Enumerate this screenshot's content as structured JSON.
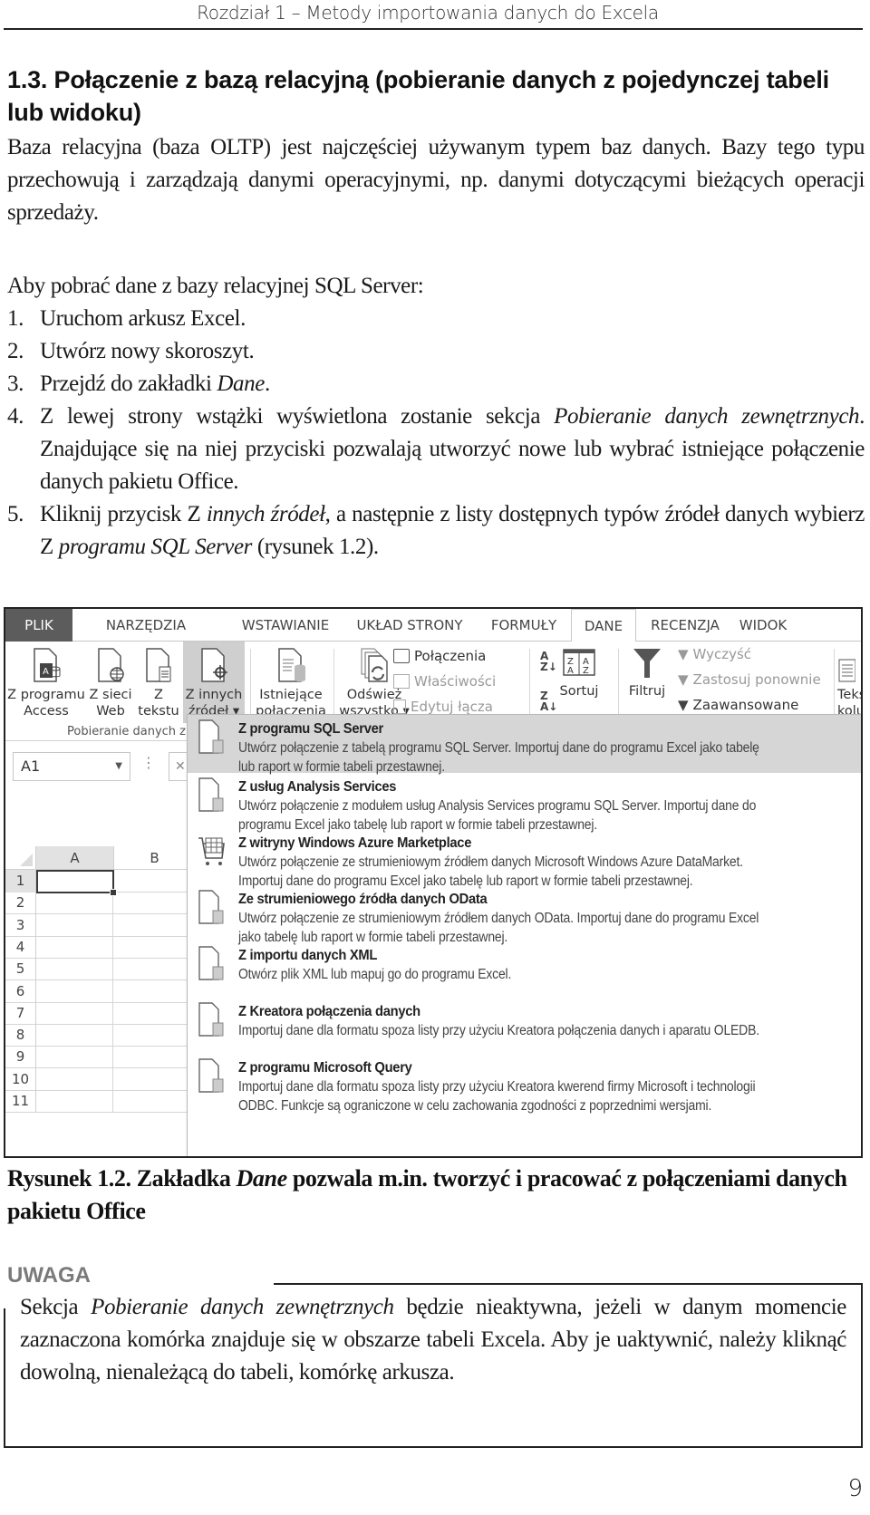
{
  "running_head": "Rozdział 1 – Metody importowania danych do Excela",
  "section_title": "1.3. Połączenie z bazą relacyjną (pobieranie danych z pojedynczej tabeli lub widoku)",
  "paragraph1": "Baza relacyjna (baza OLTP) jest najczęściej używanym typem baz danych. Bazy tego typu przechowują i zarządzają danymi operacyjnymi, np. danymi dotyczącymi bieżących operacji sprzedaży.",
  "paragraph2": "Aby pobrać dane z bazy relacyjnej SQL Server:",
  "steps": [
    {
      "num": "1.",
      "parts": [
        {
          "t": "Uruchom arkusz Excel.",
          "i": false
        }
      ]
    },
    {
      "num": "2.",
      "parts": [
        {
          "t": "Utwórz nowy skoroszyt.",
          "i": false
        }
      ]
    },
    {
      "num": "3.",
      "parts": [
        {
          "t": "Przejdź do zakładki ",
          "i": false
        },
        {
          "t": "Dane",
          "i": true
        },
        {
          "t": ".",
          "i": false
        }
      ]
    },
    {
      "num": "4.",
      "parts": [
        {
          "t": "Z lewej strony wstążki wyświetlona zostanie sekcja ",
          "i": false
        },
        {
          "t": "Pobieranie danych zewnętrznych",
          "i": true
        },
        {
          "t": ". Znajdujące się na niej przyciski pozwalają utworzyć nowe lub wybrać istniejące połączenie danych pakietu Office.",
          "i": false
        }
      ]
    },
    {
      "num": "5.",
      "parts": [
        {
          "t": "Kliknij przycisk Z ",
          "i": false
        },
        {
          "t": "innych źródeł",
          "i": true
        },
        {
          "t": ", a następnie z listy dostępnych typów źródeł danych wybierz Z ",
          "i": false
        },
        {
          "t": "programu SQL Server",
          "i": true
        },
        {
          "t": " (rysunek 1.2).",
          "i": false
        }
      ]
    }
  ],
  "excel": {
    "tabs": [
      "PLIK",
      "NARZĘDZIA GŁÓWNE",
      "WSTAWIANIE",
      "UKŁAD STRONY",
      "FORMUŁY",
      "DANE",
      "RECENZJA",
      "WIDOK"
    ],
    "active_tab": "DANE",
    "ribbon": {
      "from_access": [
        "Z programu",
        "Access"
      ],
      "from_web": [
        "Z sieci",
        "Web"
      ],
      "from_text": [
        "Z",
        "tekstu"
      ],
      "from_other": [
        "Z innych",
        "źródeł ▾"
      ],
      "existing_connections": [
        "Istniejące",
        "połączenia"
      ],
      "refresh_all": [
        "Odśwież",
        "wszystko ▾"
      ],
      "connections": "Połączenia",
      "properties": "Właściwości",
      "edit_links": "Edytuj łącza",
      "sort_az": "A→Z",
      "sort_za": "Z→A",
      "sort": "Sortuj",
      "filter": "Filtruj",
      "clear": "Wyczyść",
      "reapply": "Zastosuj ponownie",
      "advanced": "Zaawansowane",
      "text_to_columns": [
        "Tekst",
        "kolu"
      ],
      "group_label": "Pobieranie danych z"
    },
    "name_box": "A1",
    "columns": [
      "A",
      "B"
    ],
    "rows": [
      "1",
      "2",
      "3",
      "4",
      "5",
      "6",
      "7",
      "8",
      "9",
      "10",
      "11"
    ],
    "menu_items": [
      {
        "title": "Z programu SQL Server",
        "desc": [
          "Utwórz połączenie z tabelą programu SQL Server. Importuj dane do programu Excel jako tabelę",
          "lub raport w formie tabeli przestawnej."
        ],
        "highlighted": true
      },
      {
        "title": "Z usług Analysis Services",
        "desc": [
          "Utwórz połączenie z modułem usług Analysis Services programu SQL Server. Importuj dane do",
          "programu Excel jako tabelę lub raport w formie tabeli przestawnej."
        ],
        "highlighted": false
      },
      {
        "title": "Z witryny Windows Azure Marketplace",
        "desc": [
          "Utwórz połączenie ze strumieniowym źródłem danych Microsoft Windows Azure DataMarket.",
          "Importuj dane do programu Excel jako tabelę lub raport w formie tabeli przestawnej."
        ],
        "highlighted": false
      },
      {
        "title": "Ze strumieniowego źródła danych OData",
        "desc": [
          "Utwórz połączenie ze strumieniowym źródłem danych OData. Importuj dane do programu Excel",
          "jako tabelę lub raport w formie tabeli przestawnej."
        ],
        "highlighted": false
      },
      {
        "title": "Z importu danych XML",
        "desc": [
          "Otwórz plik XML lub mapuj go do programu Excel."
        ],
        "highlighted": false
      },
      {
        "title": "Z Kreatora połączenia danych",
        "desc": [
          "Importuj dane dla formatu spoza listy przy użyciu Kreatora połączenia danych i aparatu OLEDB."
        ],
        "highlighted": false
      },
      {
        "title": "Z programu Microsoft Query",
        "desc": [
          "Importuj dane dla formatu spoza listy przy użyciu Kreatora kwerend firmy Microsoft i technologii",
          "ODBC. Funkcje są ograniczone w celu zachowania zgodności z poprzednimi wersjami."
        ],
        "highlighted": false
      }
    ]
  },
  "caption": {
    "parts": [
      {
        "t": "Rysunek 1.2. Zakładka ",
        "i": false
      },
      {
        "t": "Dane",
        "i": true
      },
      {
        "t": " pozwala m.in. tworzyć i pracować z połączeniami danych pakietu Office",
        "i": false
      }
    ]
  },
  "note": {
    "label": "UWAGA",
    "parts": [
      {
        "t": "Sekcja ",
        "i": false
      },
      {
        "t": "Pobieranie danych zewnętrznych",
        "i": true
      },
      {
        "t": " będzie nieaktywna, jeżeli w danym momencie zaznaczona komórka znajduje się w obszarze tabeli Excela. Aby je uaktywnić, należy kliknąć dowolną, nienależącą do tabeli, komórkę arkusza.",
        "i": false
      }
    ]
  },
  "page_number": "9"
}
